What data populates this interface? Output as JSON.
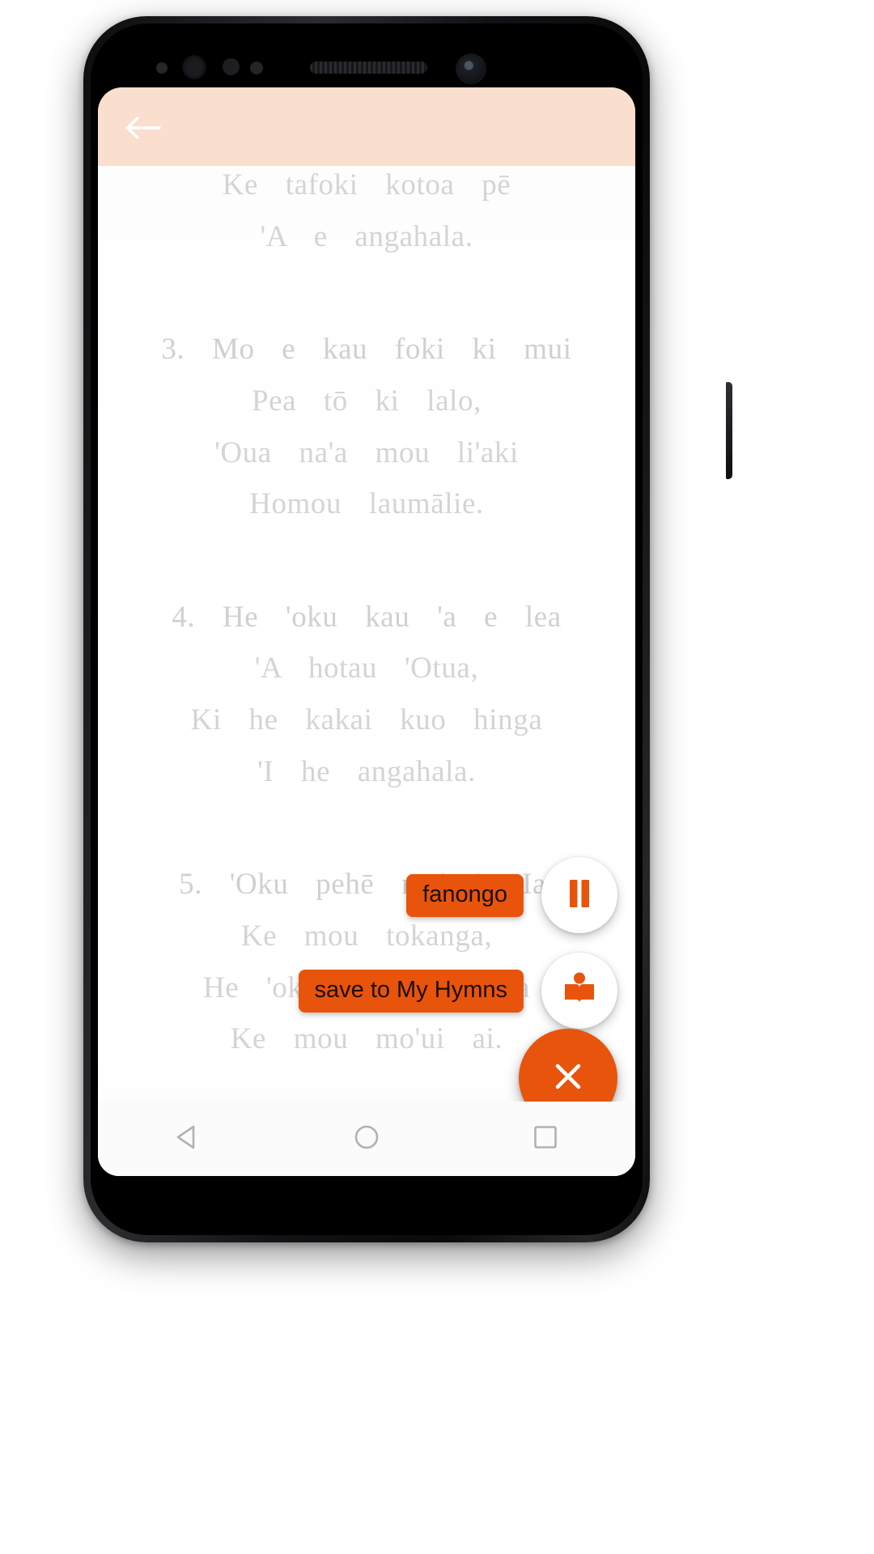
{
  "app": {
    "appbar": {
      "back_icon": "arrow-left-icon",
      "background_color": "#fadfcf"
    },
    "accent_color": "#e8540c",
    "lyrics_text_color": "#d4d4d4"
  },
  "lyrics": {
    "verses": [
      {
        "id": "verse-2-tail",
        "lines": [
          "Ke  tafoki  kotoa  pē",
          "'A  e  angahala."
        ]
      },
      {
        "id": "verse-3",
        "lines": [
          "3.  Mo  e  kau  foki  ki  mui",
          "Pea  tō  ki  lalo,",
          "'Oua  na'a  mou  li'aki",
          "Homou  laumālie."
        ]
      },
      {
        "id": "verse-4",
        "lines": [
          "4.  He  'oku  kau  'a  e  lea",
          "'A  hotau  'Otua,",
          "Ki  he  kakai  kuo  hinga",
          "'I  he  angahala."
        ]
      },
      {
        "id": "verse-5",
        "lines": [
          "5.  'Oku  pehē  mai  'e  Ia,",
          "Ke  mou  tokanga,",
          "He  'oku  Ou  anga–'ofa",
          "Ke  mou  mo'ui  ai."
        ]
      }
    ]
  },
  "fab_menu": {
    "items": [
      {
        "name": "listen",
        "label": "fanongo",
        "icon": "pause-icon"
      },
      {
        "name": "save-to-my-hymns",
        "label": "save to My Hymns",
        "icon": "open-book-icon"
      }
    ],
    "close": {
      "name": "close",
      "icon": "close-icon"
    }
  },
  "android_nav": {
    "back": "triangle-back-icon",
    "home": "circle-home-icon",
    "recents": "square-recents-icon"
  }
}
